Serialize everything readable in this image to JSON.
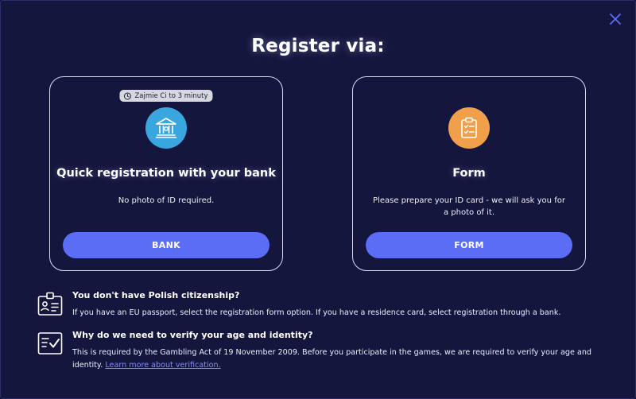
{
  "modal": {
    "title": "Register via:",
    "close_icon": "close-icon"
  },
  "cards": {
    "bank": {
      "badge": "Zajmie Ci to 3 minuty",
      "badge_icon": "clock-icon",
      "icon": "bank-building-icon",
      "icon_color": "#3aa6df",
      "title": "Quick registration with your bank",
      "description": "No photo of ID required.",
      "button_label": "BANK"
    },
    "form": {
      "icon": "clipboard-checklist-icon",
      "icon_color": "#f0a04b",
      "title": "Form",
      "description": "Please prepare your ID card - we will ask you for a photo of it.",
      "button_label": "FORM"
    }
  },
  "info": [
    {
      "icon": "id-card-icon",
      "title": "You don't have Polish citizenship?",
      "body": "If you have an EU passport, select the registration form option. If you have a residence card, select registration through a bank."
    },
    {
      "icon": "checklist-icon",
      "title": "Why do we need to verify your age and identity?",
      "body": "This is required by the Gambling Act of 19 November 2009. Before you participate in the games, we are required to verify your age and identity.",
      "link": "Learn more about verification."
    }
  ],
  "colors": {
    "background": "#15163d",
    "button": "#5b6df5",
    "link": "#7f8cff",
    "close": "#5b6df5"
  }
}
